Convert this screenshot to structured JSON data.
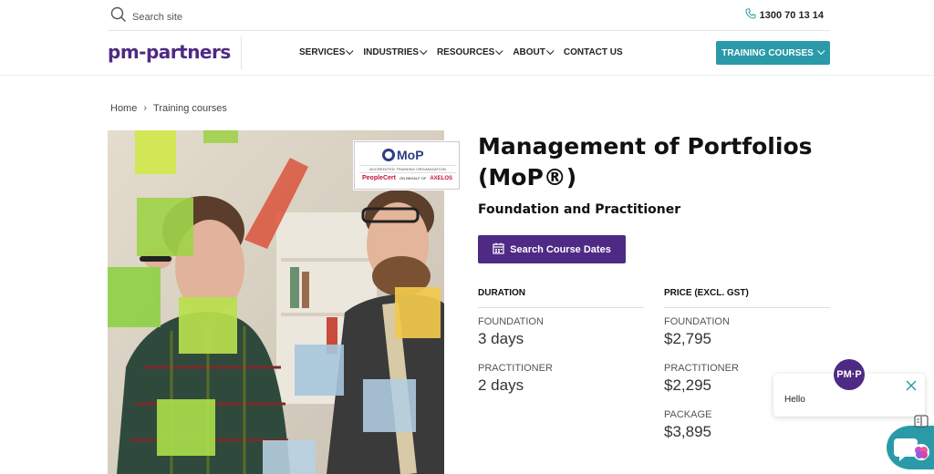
{
  "header": {
    "search_placeholder": "Search site",
    "phone": "1300 70 13 14"
  },
  "nav": {
    "logo": "pm-partners",
    "items": [
      {
        "label": "SERVICES",
        "dropdown": true
      },
      {
        "label": "INDUSTRIES",
        "dropdown": true
      },
      {
        "label": "RESOURCES",
        "dropdown": true
      },
      {
        "label": "ABOUT",
        "dropdown": true
      },
      {
        "label": "CONTACT US",
        "dropdown": false
      }
    ],
    "cta": "TRAINING COURSES"
  },
  "breadcrumb": {
    "home": "Home",
    "current": "Training courses"
  },
  "badge": {
    "brand": "MoP",
    "subtitle": "ACCREDITED TRAINING ORGANIZATION",
    "partner": "PeopleCert",
    "behalf": "ON BEHALF OF",
    "axelos": "AXELOS"
  },
  "course": {
    "title": "Management of Portfolios (MoP®)",
    "subtitle": "Foundation and Practitioner",
    "search_button": "Search Course Dates"
  },
  "duration": {
    "heading": "DURATION",
    "rows": [
      {
        "label": "FOUNDATION",
        "value": "3 days"
      },
      {
        "label": "PRACTITIONER",
        "value": "2 days"
      }
    ]
  },
  "price": {
    "heading": "PRICE (EXCL. GST)",
    "rows": [
      {
        "label": "FOUNDATION",
        "value": "$2,795"
      },
      {
        "label": "PRACTITIONER",
        "value": "$2,295"
      },
      {
        "label": "PACKAGE",
        "value": "$3,895"
      }
    ]
  },
  "chat": {
    "avatar": "PM·P",
    "message": "Hello"
  },
  "colors": {
    "brand_purple": "#4e2a84",
    "accent_teal": "#2a9aa8"
  }
}
